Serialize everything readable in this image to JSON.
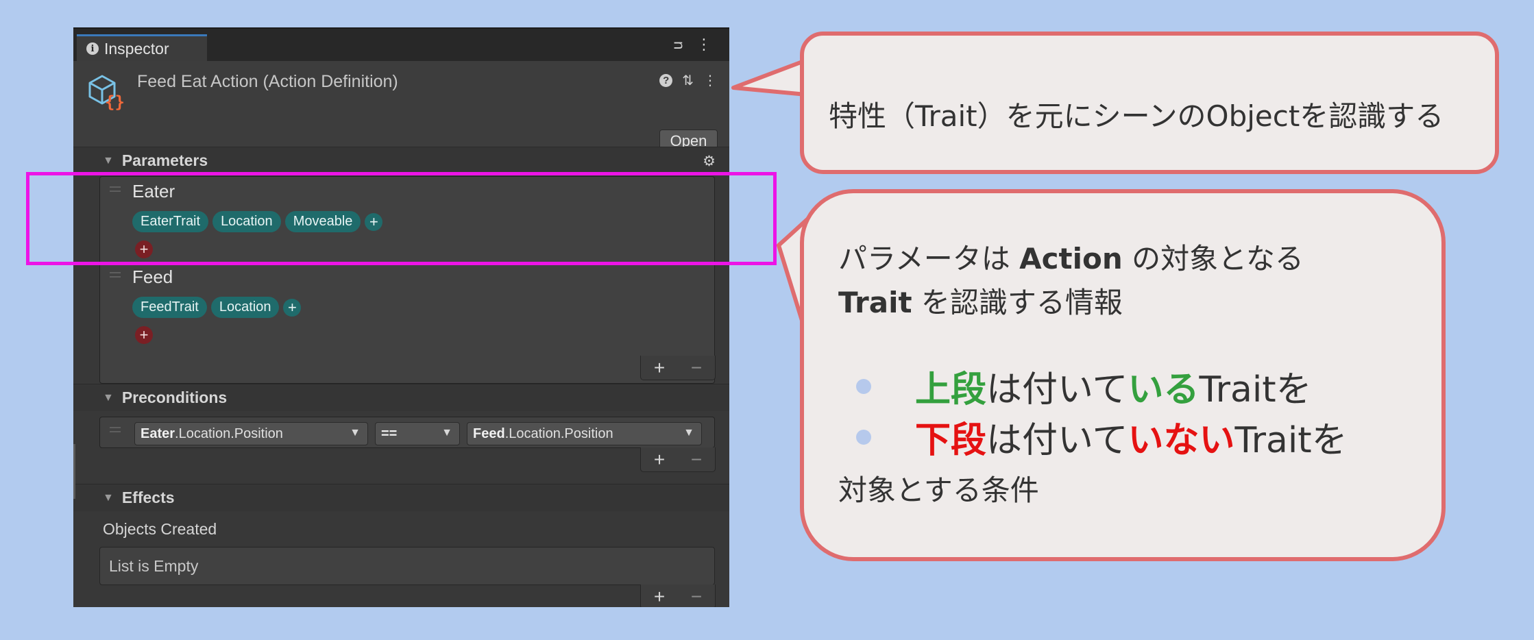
{
  "inspector": {
    "tab_label": "Inspector",
    "title": "Feed Eat Action (Action Definition)",
    "open_label": "Open",
    "sections": {
      "parameters": "Parameters",
      "preconditions": "Preconditions",
      "effects": "Effects"
    },
    "parameters": [
      {
        "name": "Eater",
        "traits": [
          "EaterTrait",
          "Location",
          "Moveable"
        ]
      },
      {
        "name": "Feed",
        "traits": [
          "FeedTrait",
          "Location"
        ]
      }
    ],
    "precondition": {
      "left_bold": "Eater",
      "left_rest": ".Location.Position",
      "operator": "==",
      "right_bold": "Feed",
      "right_rest": ".Location.Position"
    },
    "effects": {
      "objects_created_label": "Objects Created",
      "empty_text": "List is Empty"
    },
    "plus": "+",
    "minus": "−"
  },
  "callout1": {
    "text": "特性（Trait）を元にシーンのObjectを認識する"
  },
  "callout2": {
    "line1_pre": "パラメータは ",
    "line1_bold": "Action",
    "line1_post": " の対象となる",
    "line2_bold": "Trait",
    "line2_post": " を認識する情報",
    "bullet1_a": "上段",
    "bullet1_b": "は付いて",
    "bullet1_c": "いる",
    "bullet1_d": "Traitを",
    "bullet2_a": "下段",
    "bullet2_b": "は付いて",
    "bullet2_c": "いない",
    "bullet2_d": "Traitを",
    "line5": "対象とする条件"
  },
  "colors": {
    "highlight": "#ec14e6",
    "bubble_border": "#df6c6e",
    "green": "#34a03e",
    "red": "#e51212"
  }
}
